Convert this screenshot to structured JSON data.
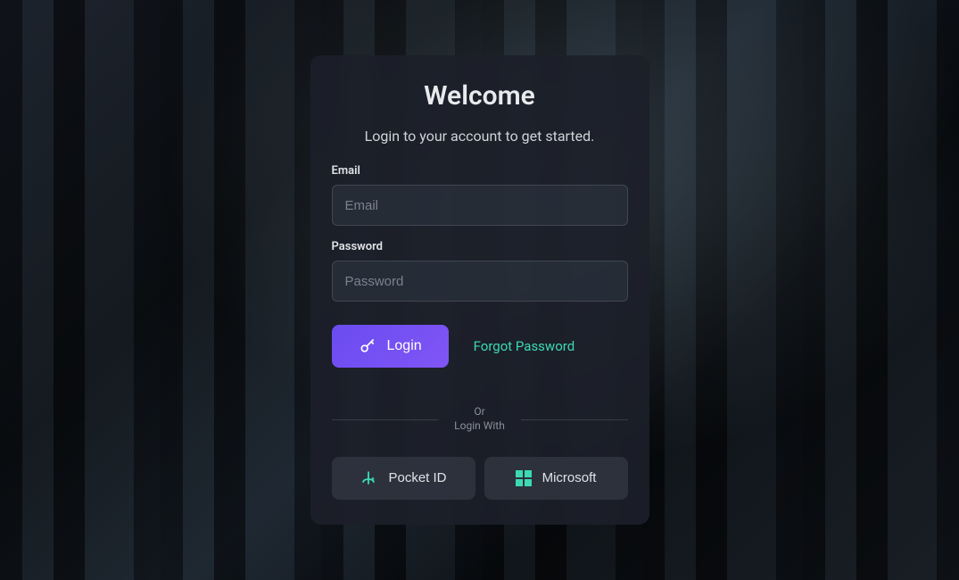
{
  "header": {
    "title": "Welcome",
    "subtitle": "Login to your account to get started."
  },
  "form": {
    "email": {
      "label": "Email",
      "placeholder": "Email",
      "value": ""
    },
    "password": {
      "label": "Password",
      "placeholder": "Password",
      "value": ""
    }
  },
  "actions": {
    "login_label": "Login",
    "forgot_label": "Forgot Password"
  },
  "divider": {
    "line1": "Or",
    "line2": "Login With"
  },
  "oauth": {
    "pocket_id_label": "Pocket ID",
    "microsoft_label": "Microsoft"
  }
}
